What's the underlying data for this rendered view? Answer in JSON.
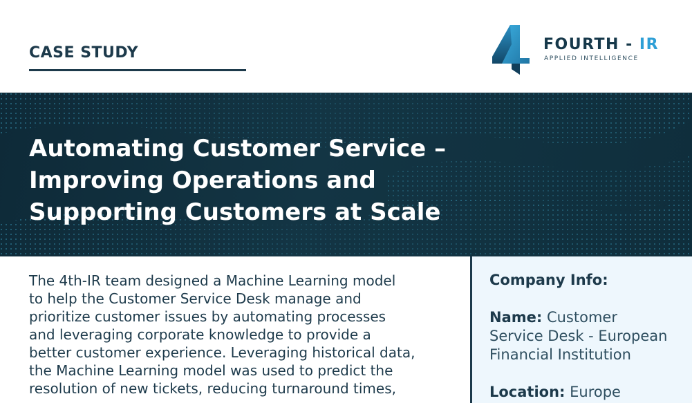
{
  "header": {
    "label": "CASE STUDY",
    "logo": {
      "name_main": "FOURTH - ",
      "name_accent": "IR",
      "tagline": "APPLIED INTELLIGENCE",
      "icon": "four-logo-icon"
    }
  },
  "hero": {
    "title_lines": [
      "Automating Customer Service –",
      "Improving Operations and",
      "Supporting Customers at Scale"
    ]
  },
  "body": {
    "lines": [
      "The 4th-IR team designed a Machine Learning model",
      "to help the Customer Service Desk manage and",
      "prioritize customer issues by automating processes",
      "and leveraging corporate knowledge to provide a",
      "better customer experience. Leveraging historical data,",
      "the Machine Learning model was used to predict the",
      "resolution of new tickets, reducing turnaround times,"
    ]
  },
  "company_info": {
    "title": "Company Info:",
    "name_key": "Name:",
    "name_value_lines": [
      " Customer",
      "Service Desk - European",
      "Financial Institution"
    ],
    "location_key": "Location:",
    "location_value": " Europe"
  },
  "colors": {
    "navy": "#1d3a4b",
    "accent_blue": "#2e9fd6",
    "hero_bg": "#0f2e3c",
    "panel_bg": "#eef7fd"
  }
}
